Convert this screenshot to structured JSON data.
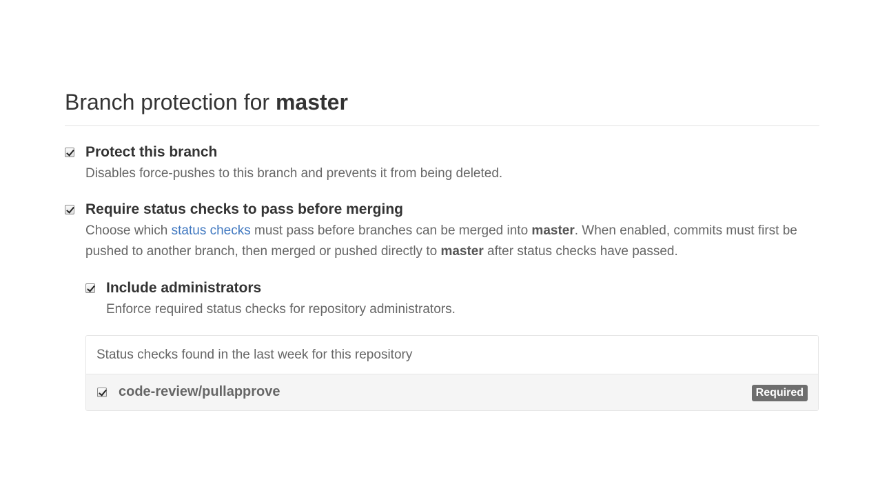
{
  "header": {
    "title_prefix": "Branch protection for ",
    "branch": "master"
  },
  "options": {
    "protect": {
      "label": "Protect this branch",
      "description": "Disables force-pushes to this branch and prevents it from being deleted.",
      "checked": true
    },
    "status_checks": {
      "label": "Require status checks to pass before merging",
      "desc_part1": "Choose which ",
      "link_text": "status checks",
      "desc_part2": " must pass before branches can be merged into ",
      "branch1": "master",
      "desc_part3": ". When enabled, commits must first be",
      "desc_part4": "pushed to another branch, then merged or pushed directly to ",
      "branch2": "master",
      "desc_part5": " after status checks have passed.",
      "checked": true
    },
    "include_admins": {
      "label": "Include administrators",
      "description": "Enforce required status checks for repository administrators.",
      "checked": true
    }
  },
  "checks_panel": {
    "heading": "Status checks found in the last week for this repository",
    "items": [
      {
        "name": "code-review/pullapprove",
        "badge": "Required",
        "checked": true
      }
    ]
  }
}
